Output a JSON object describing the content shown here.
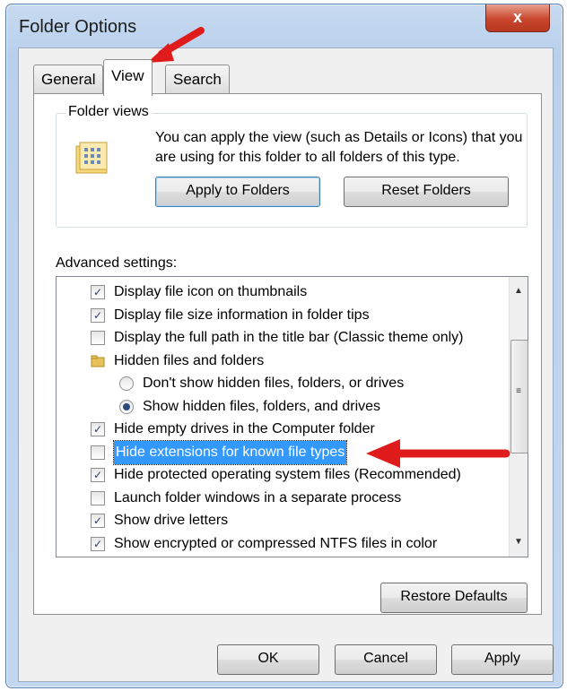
{
  "window": {
    "title": "Folder Options",
    "close_glyph": "x"
  },
  "tabs": [
    {
      "label": "General",
      "active": false
    },
    {
      "label": "View",
      "active": true
    },
    {
      "label": "Search",
      "active": false
    }
  ],
  "folder_views": {
    "legend": "Folder views",
    "description": "You can apply the view (such as Details or Icons) that you are using for this folder to all folders of this type.",
    "apply_button": "Apply to Folders",
    "reset_button": "Reset Folders"
  },
  "advanced": {
    "label": "Advanced settings:",
    "items": [
      {
        "type": "checkbox",
        "checked": true,
        "indent": 1,
        "label": "Display file icon on thumbnails"
      },
      {
        "type": "checkbox",
        "checked": true,
        "indent": 1,
        "label": "Display file size information in folder tips"
      },
      {
        "type": "checkbox",
        "checked": false,
        "indent": 1,
        "label": "Display the full path in the title bar (Classic theme only)"
      },
      {
        "type": "folder",
        "checked": false,
        "indent": 1,
        "label": "Hidden files and folders"
      },
      {
        "type": "radio",
        "checked": false,
        "indent": 2,
        "label": "Don't show hidden files, folders, or drives"
      },
      {
        "type": "radio",
        "checked": true,
        "indent": 2,
        "label": "Show hidden files, folders, and drives"
      },
      {
        "type": "checkbox",
        "checked": true,
        "indent": 1,
        "label": "Hide empty drives in the Computer folder"
      },
      {
        "type": "checkbox",
        "checked": false,
        "indent": 1,
        "label": "Hide extensions for known file types",
        "highlighted": true
      },
      {
        "type": "checkbox",
        "checked": true,
        "indent": 1,
        "label": "Hide protected operating system files (Recommended)"
      },
      {
        "type": "checkbox",
        "checked": false,
        "indent": 1,
        "label": "Launch folder windows in a separate process"
      },
      {
        "type": "checkbox",
        "checked": true,
        "indent": 1,
        "label": "Show drive letters"
      },
      {
        "type": "checkbox",
        "checked": true,
        "indent": 1,
        "label": "Show encrypted or compressed NTFS files in color"
      }
    ],
    "restore_button": "Restore Defaults"
  },
  "footer": {
    "ok": "OK",
    "cancel": "Cancel",
    "apply": "Apply"
  },
  "colors": {
    "highlight": "#3399ff",
    "annotation_arrow": "#e01b1b"
  }
}
